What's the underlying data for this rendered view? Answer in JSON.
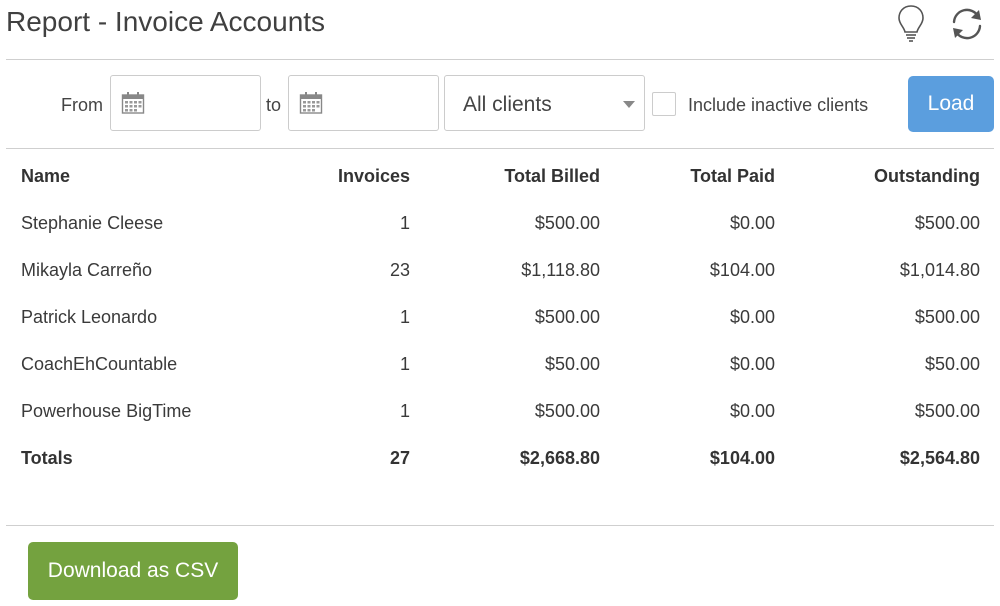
{
  "header": {
    "title": "Report - Invoice Accounts",
    "icons": [
      "lightbulb-icon",
      "refresh-icon"
    ]
  },
  "filters": {
    "from_label": "From",
    "to_label": "to",
    "from_value": "",
    "to_value": "",
    "client_select_value": "All clients",
    "include_inactive_label": "Include inactive clients",
    "include_inactive_checked": false,
    "load_button": "Load"
  },
  "table": {
    "headers": {
      "name": "Name",
      "invoices": "Invoices",
      "total_billed": "Total Billed",
      "total_paid": "Total Paid",
      "outstanding": "Outstanding"
    },
    "rows": [
      {
        "name": "Stephanie Cleese",
        "invoices": "1",
        "total_billed": "$500.00",
        "total_paid": "$0.00",
        "outstanding": "$500.00"
      },
      {
        "name": "Mikayla Carreño",
        "invoices": "23",
        "total_billed": "$1,118.80",
        "total_paid": "$104.00",
        "outstanding": "$1,014.80"
      },
      {
        "name": "Patrick Leonardo",
        "invoices": "1",
        "total_billed": "$500.00",
        "total_paid": "$0.00",
        "outstanding": "$500.00"
      },
      {
        "name": "CoachEhCountable",
        "invoices": "1",
        "total_billed": "$50.00",
        "total_paid": "$0.00",
        "outstanding": "$50.00"
      },
      {
        "name": "Powerhouse BigTime",
        "invoices": "1",
        "total_billed": "$500.00",
        "total_paid": "$0.00",
        "outstanding": "$500.00"
      }
    ],
    "totals": {
      "name": "Totals",
      "invoices": "27",
      "total_billed": "$2,668.80",
      "total_paid": "$104.00",
      "outstanding": "$2,564.80"
    }
  },
  "footer": {
    "download_button": "Download as CSV"
  },
  "colors": {
    "load_button": "#5b9ede",
    "download_button": "#74a23f"
  }
}
